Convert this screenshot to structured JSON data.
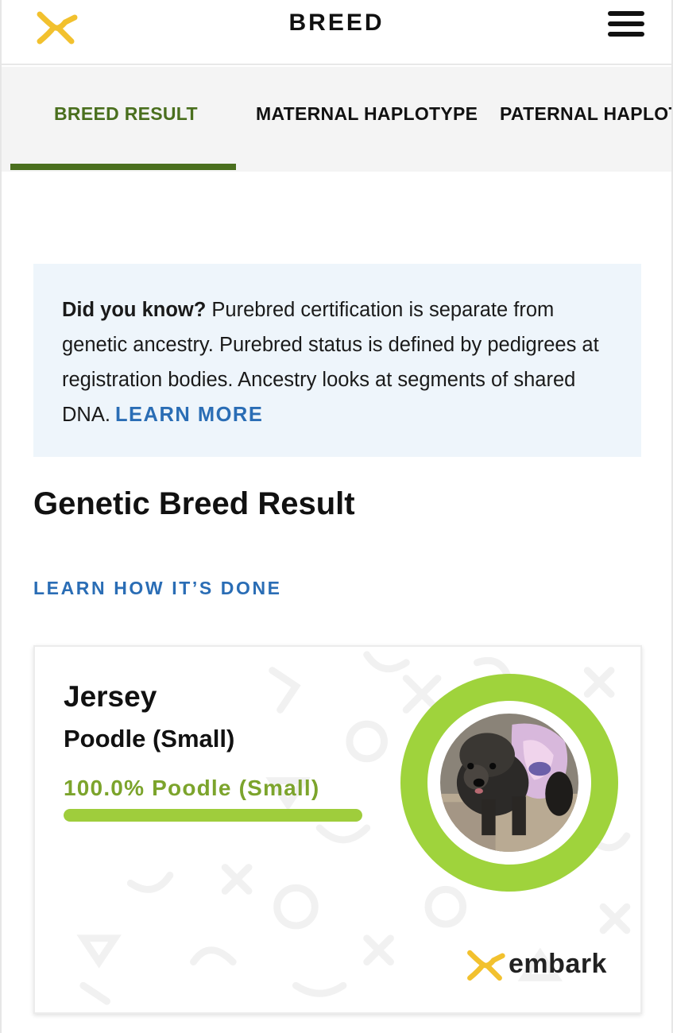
{
  "header": {
    "title": "BREED",
    "logo_icon": "embark-x-icon",
    "menu_icon": "hamburger-icon",
    "accent_color": "#f2c12e"
  },
  "tabs": [
    {
      "label": "BREED RESULT",
      "active": true
    },
    {
      "label": "MATERNAL HAPLOTYPE",
      "active": false
    },
    {
      "label": "PATERNAL HAPLOT",
      "active": false
    }
  ],
  "info": {
    "lead": "Did you know?",
    "text": " Purebred certification is separate from genetic ancestry. Purebred status is defined by pedigrees at registration bodies. Ancestry looks at segments of shared DNA.",
    "link": "LEARN MORE",
    "link_color": "#2a6db5",
    "bg_color": "#eef5fb"
  },
  "section": {
    "title": "Genetic Breed Result",
    "learn_link": "LEARN HOW IT’S DONE"
  },
  "result": {
    "dog_name": "Jersey",
    "breed": "Poodle (Small)",
    "breakdown_label": "100.0% Poodle (Small)",
    "percent": 100,
    "bar_color": "#9fcd3c",
    "ring_color": "#9fd33c",
    "brand": "embark"
  }
}
